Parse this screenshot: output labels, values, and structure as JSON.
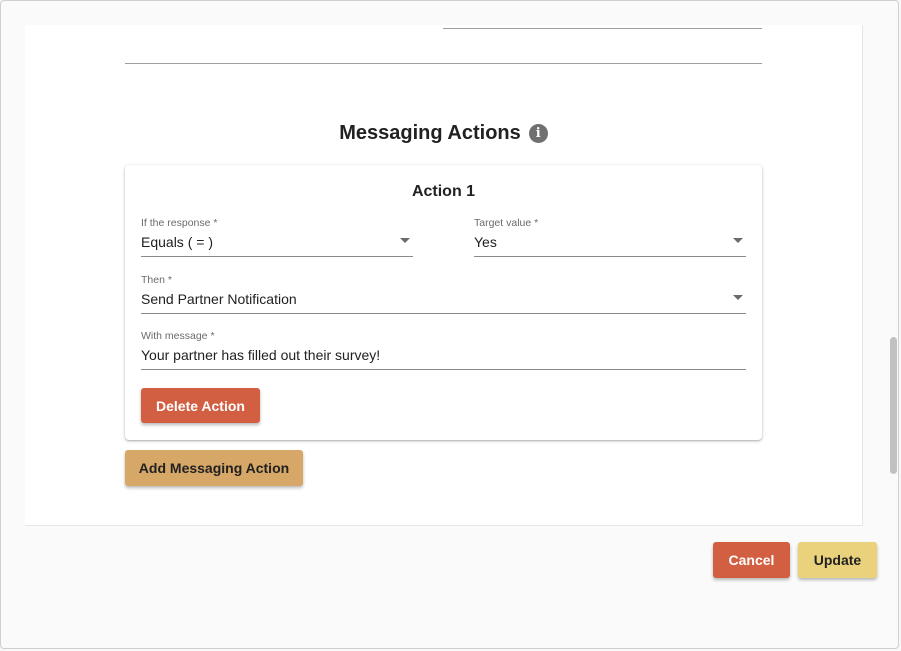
{
  "section": {
    "title": "Messaging Actions",
    "info_icon": "info-icon"
  },
  "action": {
    "title": "Action 1",
    "condition": {
      "label": "If the response *",
      "value": "Equals ( = )"
    },
    "target": {
      "label": "Target value *",
      "value": "Yes"
    },
    "then": {
      "label": "Then *",
      "value": "Send Partner Notification"
    },
    "message": {
      "label": "With message *",
      "value": "Your partner has filled out their survey!"
    },
    "delete_label": "Delete Action"
  },
  "add_label": "Add Messaging Action",
  "footer": {
    "cancel_label": "Cancel",
    "update_label": "Update"
  },
  "colors": {
    "danger": "#d35f43",
    "add": "#d6a767",
    "update": "#ead27d"
  }
}
